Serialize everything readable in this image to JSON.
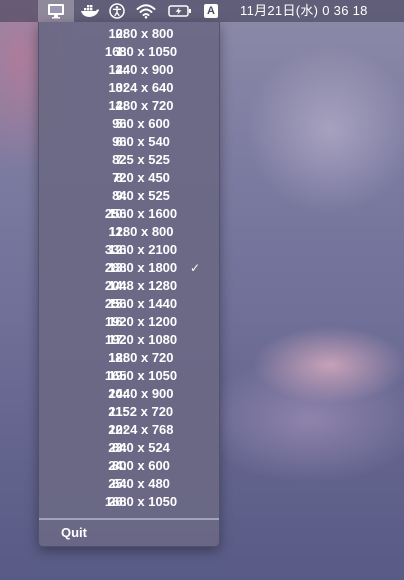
{
  "menubar": {
    "input_source": "A",
    "clock": "11月21日(水)  0 36 18"
  },
  "menu": {
    "items": [
      {
        "index": "0:",
        "resolution": "1280 x 800",
        "checked": false
      },
      {
        "index": "1:",
        "resolution": "1680 x 1050",
        "checked": false
      },
      {
        "index": "2:",
        "resolution": "1440 x 900",
        "checked": false
      },
      {
        "index": "3:",
        "resolution": "1024 x 640",
        "checked": false
      },
      {
        "index": "4:",
        "resolution": "1280 x 720",
        "checked": false
      },
      {
        "index": "5:",
        "resolution": "960 x 600",
        "checked": false
      },
      {
        "index": "6:",
        "resolution": "960 x 540",
        "checked": false
      },
      {
        "index": "7:",
        "resolution": "825 x 525",
        "checked": false
      },
      {
        "index": "8:",
        "resolution": "720 x 450",
        "checked": false
      },
      {
        "index": "9:",
        "resolution": "840 x 525",
        "checked": false
      },
      {
        "index": "10:",
        "resolution": "2560 x 1600",
        "checked": false
      },
      {
        "index": "11:",
        "resolution": "1280 x 800",
        "checked": false
      },
      {
        "index": "12:",
        "resolution": "3360 x 2100",
        "checked": false
      },
      {
        "index": "13:",
        "resolution": "2880 x 1800",
        "checked": true
      },
      {
        "index": "14:",
        "resolution": "2048 x 1280",
        "checked": false
      },
      {
        "index": "15:",
        "resolution": "2560 x 1440",
        "checked": false
      },
      {
        "index": "16:",
        "resolution": "1920 x 1200",
        "checked": false
      },
      {
        "index": "17:",
        "resolution": "1920 x 1080",
        "checked": false
      },
      {
        "index": "18:",
        "resolution": "1280 x 720",
        "checked": false
      },
      {
        "index": "19:",
        "resolution": "1650 x 1050",
        "checked": false
      },
      {
        "index": "20:",
        "resolution": "1440 x 900",
        "checked": false
      },
      {
        "index": "21:",
        "resolution": "1152 x 720",
        "checked": false
      },
      {
        "index": "22:",
        "resolution": "1024 x 768",
        "checked": false
      },
      {
        "index": "23:",
        "resolution": "840 x 524",
        "checked": false
      },
      {
        "index": "24:",
        "resolution": "800 x 600",
        "checked": false
      },
      {
        "index": "25:",
        "resolution": "640 x 480",
        "checked": false
      },
      {
        "index": "26:",
        "resolution": "1680 x 1050",
        "checked": false
      }
    ],
    "checkmark": "✓",
    "quit_label": "Quit"
  },
  "icons": [
    "monitor-icon",
    "docker-icon",
    "accessibility-icon",
    "wifi-icon",
    "battery-charging-icon",
    "input-source-icon"
  ]
}
